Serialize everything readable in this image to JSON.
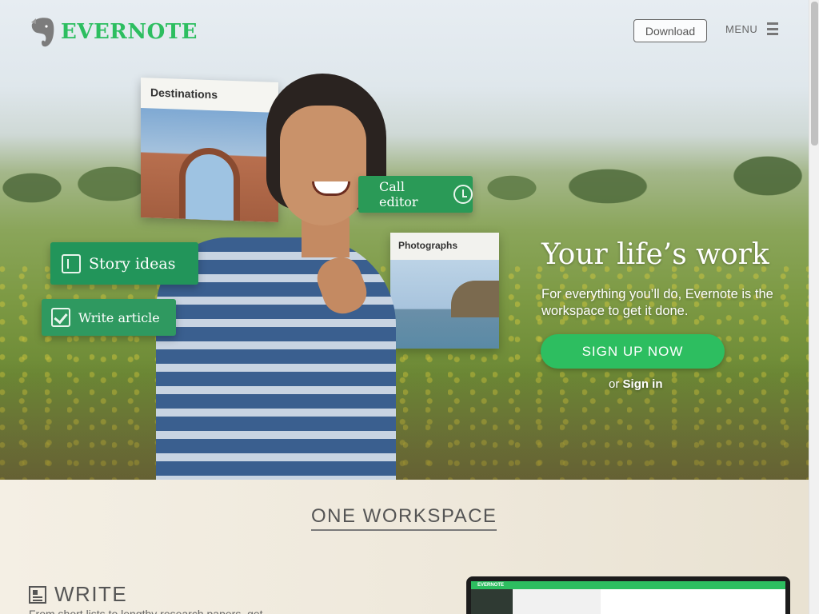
{
  "header": {
    "brand": "EVERNOTE",
    "download_label": "Download",
    "menu_label": "MENU"
  },
  "hero": {
    "cards": {
      "destinations": "Destinations",
      "call_editor": "Call editor",
      "story_ideas": "Story ideas",
      "write_article": "Write article",
      "photographs": "Photographs"
    },
    "headline": "Your life’s work",
    "subline": "For everything you’ll do, Evernote is the workspace to get it done.",
    "signup_label": "SIGN UP NOW",
    "signin_prefix": "or",
    "signin_label": "Sign in"
  },
  "section": {
    "title": "ONE WORKSPACE",
    "write_heading": "WRITE",
    "write_desc": "From short lists to lengthy research papers, get"
  },
  "laptop_preview": {
    "app_name": "EVERNOTE"
  },
  "colors": {
    "brand_green": "#2dbe60",
    "card_green": "#2a9a57",
    "section_bg": "#efe9dc"
  },
  "icons": [
    "evernote-elephant-icon",
    "hamburger-icon",
    "book-icon",
    "checkbox-icon",
    "alarm-clock-icon",
    "document-icon"
  ]
}
